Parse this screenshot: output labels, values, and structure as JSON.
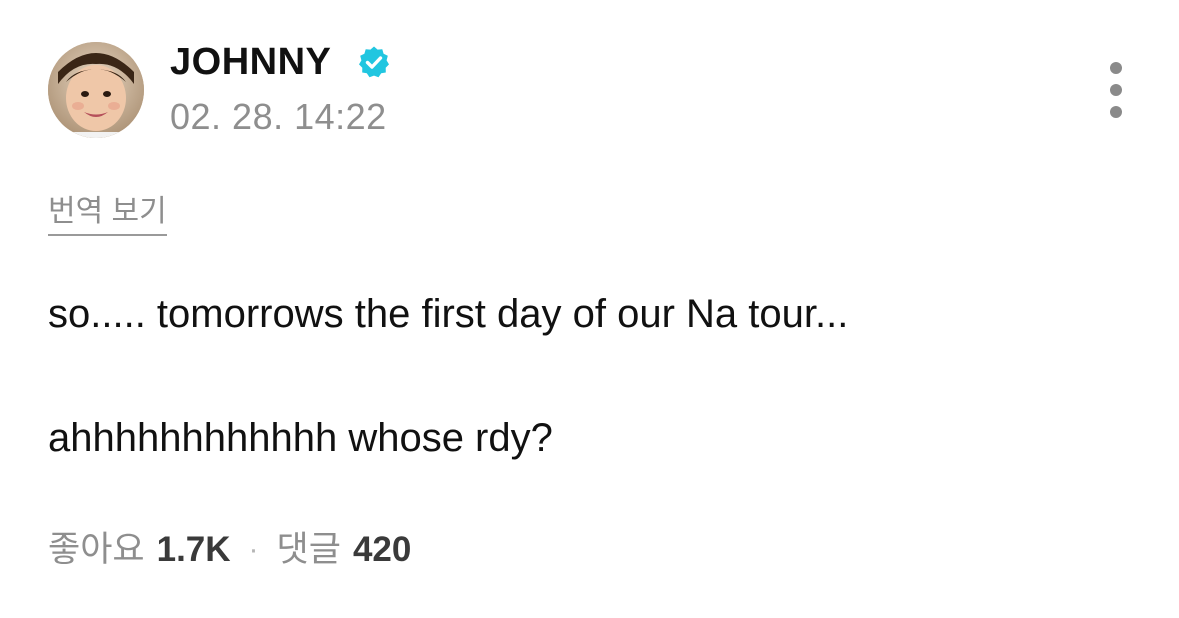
{
  "post": {
    "author": {
      "name": "JOHNNY",
      "verified": true,
      "avatar_icon": "profile-photo"
    },
    "timestamp": "02. 28. 14:22",
    "translate_label": "번역 보기",
    "body": [
      "so..... tomorrows the first day of our Na tour...",
      "ahhhhhhhhhhhh whose rdy?"
    ],
    "likes_label": "좋아요",
    "likes_count": "1.7K",
    "separator": "·",
    "comments_label": "댓글",
    "comments_count": "420"
  },
  "colors": {
    "verified_badge": "#21c6e0",
    "secondary_text": "#8e8e8e",
    "primary_text": "#111111"
  },
  "icons": {
    "more": "more-vertical-icon",
    "verified": "verified-badge-icon"
  }
}
